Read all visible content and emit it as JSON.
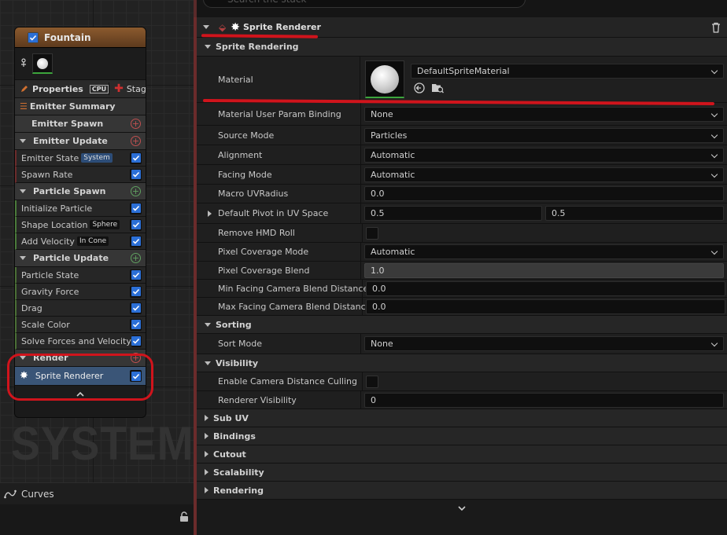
{
  "left_panel": {
    "watermark": "SYSTEM",
    "emitter": {
      "title": "Fountain",
      "properties_label": "Properties",
      "cpu_label": "CPU",
      "stage_label": "Stage",
      "summary_label": "Emitter Summary",
      "groups": [
        {
          "label": "Emitter Spawn",
          "items": []
        },
        {
          "label": "Emitter Update",
          "items": [
            {
              "label": "Emitter State",
              "tag": "System"
            },
            {
              "label": "Spawn Rate",
              "tag": ""
            }
          ]
        },
        {
          "label": "Particle Spawn",
          "items": [
            {
              "label": "Initialize Particle",
              "tag": ""
            },
            {
              "label": "Shape Location",
              "tag": "Sphere"
            },
            {
              "label": "Add Velocity",
              "tag": "In Cone"
            }
          ]
        },
        {
          "label": "Particle Update",
          "items": [
            {
              "label": "Particle State",
              "tag": ""
            },
            {
              "label": "Gravity Force",
              "tag": ""
            },
            {
              "label": "Drag",
              "tag": ""
            },
            {
              "label": "Scale Color",
              "tag": ""
            },
            {
              "label": "Solve Forces and Velocity",
              "tag": ""
            }
          ]
        },
        {
          "label": "Render",
          "items": [
            {
              "label": "Sprite Renderer",
              "tag": ""
            }
          ]
        }
      ]
    },
    "curves_label": "Curves"
  },
  "right_panel": {
    "search_placeholder": "Search the stack",
    "header_title": "Sprite Renderer",
    "sections": {
      "sprite_rendering": "Sprite Rendering",
      "sorting": "Sorting",
      "visibility": "Visibility",
      "collapsed": [
        "Sub UV",
        "Bindings",
        "Cutout",
        "Scalability",
        "Rendering"
      ]
    },
    "material": {
      "label": "Material",
      "value": "DefaultSpriteMaterial"
    },
    "properties": [
      {
        "label": "Material User Param Binding",
        "type": "dropdown",
        "value": "None"
      },
      {
        "label": "Source Mode",
        "type": "dropdown",
        "value": "Particles"
      },
      {
        "label": "Alignment",
        "type": "dropdown",
        "value": "Automatic"
      },
      {
        "label": "Facing Mode",
        "type": "dropdown",
        "value": "Automatic"
      },
      {
        "label": "Macro UVRadius",
        "type": "number",
        "value": "0.0"
      },
      {
        "label": "Default Pivot in UV Space",
        "type": "pair",
        "value": "0.5",
        "value2": "0.5"
      },
      {
        "label": "Remove HMD Roll",
        "type": "checkbox",
        "value": ""
      },
      {
        "label": "Pixel Coverage Mode",
        "type": "dropdown",
        "value": "Automatic"
      },
      {
        "label": "Pixel Coverage Blend",
        "type": "numgrey",
        "value": "1.0"
      },
      {
        "label": "Min Facing Camera Blend Distance",
        "type": "number",
        "value": "0.0"
      },
      {
        "label": "Max Facing Camera Blend Distance",
        "type": "number",
        "value": "0.0"
      }
    ],
    "sorting": [
      {
        "label": "Sort Mode",
        "type": "dropdown",
        "value": "None"
      }
    ],
    "visibility": [
      {
        "label": "Enable Camera Distance Culling",
        "type": "checkbox",
        "value": ""
      },
      {
        "label": "Renderer Visibility",
        "type": "number",
        "value": "0"
      }
    ]
  },
  "colors": {
    "annotation_red": "#d0141c",
    "accent_green": "#3ca53c",
    "selected_blue": "#3a5577"
  }
}
